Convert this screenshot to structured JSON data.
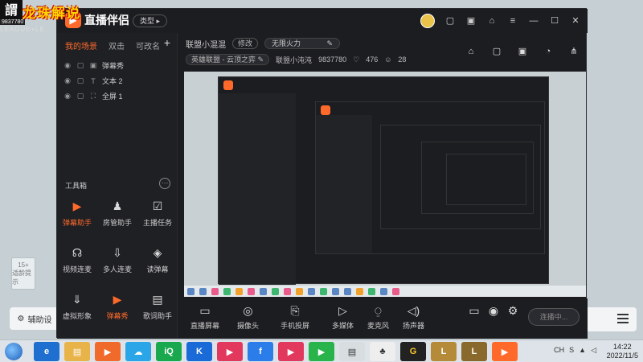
{
  "stream_logo": {
    "badge": "謂",
    "text": "龙珠解说",
    "id": "9837780",
    "league": "LEAGUE+LE"
  },
  "app": {
    "title": "直播伴侣",
    "type_label": "类型",
    "accent": "#ff6a2b"
  },
  "scene_tabs": [
    "我的场景",
    "双击",
    "可改名"
  ],
  "sources": [
    {
      "kind": "lock",
      "label": "弹幕秀"
    },
    {
      "kind": "text",
      "label": "文本 2"
    },
    {
      "kind": "fullscreen",
      "label": "全屏 1"
    }
  ],
  "tools": {
    "title": "工具箱",
    "items": [
      {
        "label": "弹幕助手",
        "icon": "bullet-chat-icon",
        "active": true
      },
      {
        "label": "房管助手",
        "icon": "admin-icon",
        "active": false
      },
      {
        "label": "主播任务",
        "icon": "task-icon",
        "active": false
      },
      {
        "label": "视频连麦",
        "icon": "video-call-icon",
        "active": false
      },
      {
        "label": "多人连麦",
        "icon": "multi-call-icon",
        "active": false
      },
      {
        "label": "读弹幕",
        "icon": "read-icon",
        "active": false
      },
      {
        "label": "虚拟形象",
        "icon": "avatar-icon",
        "active": false
      },
      {
        "label": "弹幕秀",
        "icon": "show-icon",
        "active": true
      },
      {
        "label": "歌词助手",
        "icon": "lyrics-icon",
        "active": false
      }
    ]
  },
  "info": {
    "room_name": "联盟小混混",
    "edit_label": "修改",
    "stream_title": "无限火力",
    "category": "英雄联盟 - 云顶之弈",
    "room_label": "联盟小沌沌",
    "room_id": "9837780",
    "likes": "476",
    "viewers": "28"
  },
  "bottom_tools": [
    {
      "label": "直播屏幕",
      "icon": "screen-icon"
    },
    {
      "label": "摄像头",
      "icon": "camera-icon"
    },
    {
      "label": "手机投屏",
      "icon": "phone-icon"
    },
    {
      "label": "多媒体",
      "icon": "media-icon"
    },
    {
      "label": "麦克风",
      "icon": "mic-icon"
    },
    {
      "label": "扬声器",
      "icon": "speaker-icon"
    }
  ],
  "go_live": "连播中...",
  "desktop_card": "辅助设",
  "clock": {
    "time": "14:22",
    "date": "2022/11/5"
  }
}
